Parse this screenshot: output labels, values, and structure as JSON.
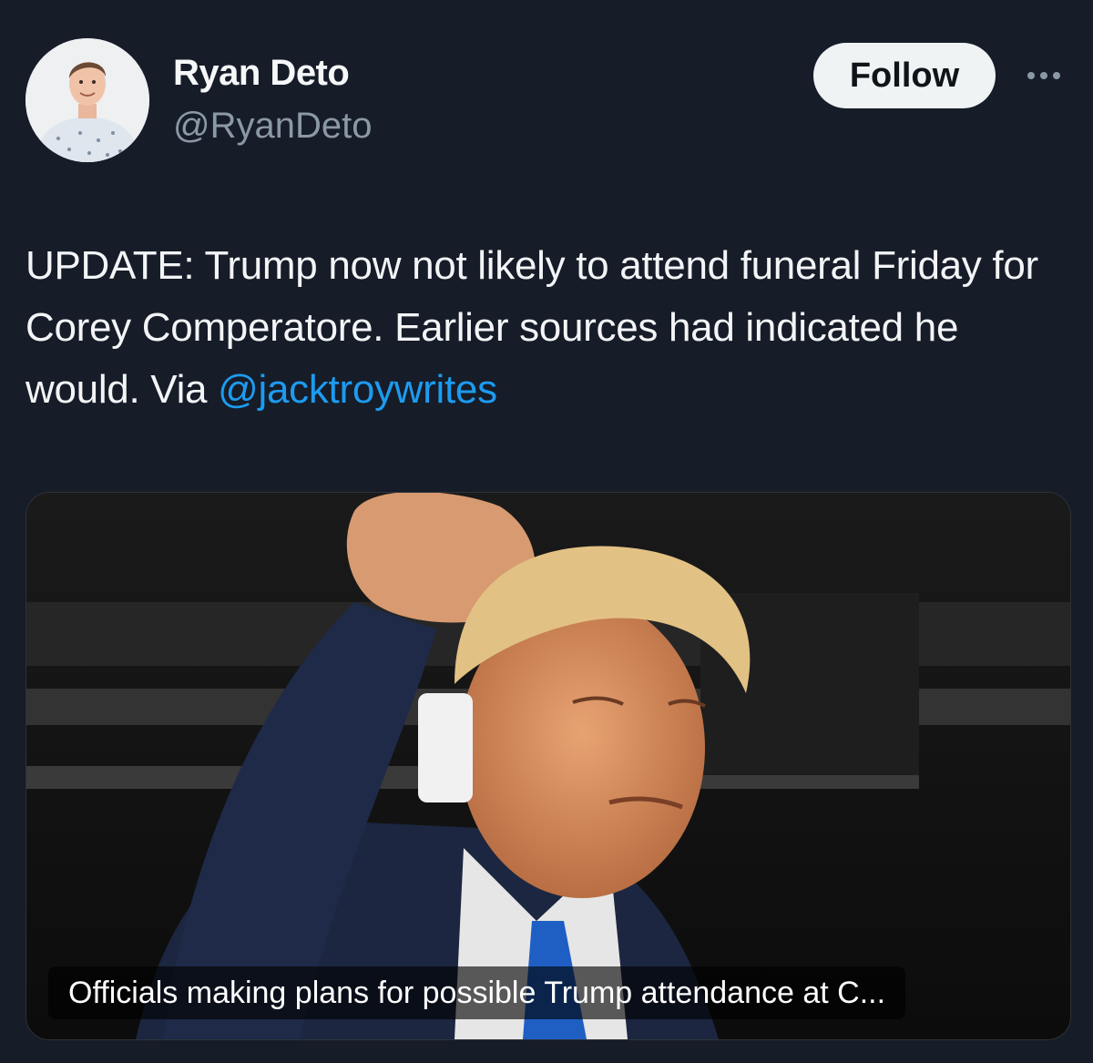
{
  "author": {
    "display_name": "Ryan Deto",
    "handle": "@RyanDeto",
    "avatar_icon": "profile-photo"
  },
  "actions": {
    "follow_label": "Follow",
    "more_icon": "ellipsis-icon"
  },
  "tweet": {
    "text": "UPDATE: Trump now not likely to attend funeral Friday for Corey Comperatore. Earlier sources had indicated he would. Via ",
    "mention": "@jacktroywrites"
  },
  "link_card": {
    "caption": "Officials making plans for possible Trump attendance at C..."
  },
  "colors": {
    "background": "#161c28",
    "mention": "#1d9bf0",
    "follow_bg": "#eff3f4"
  }
}
